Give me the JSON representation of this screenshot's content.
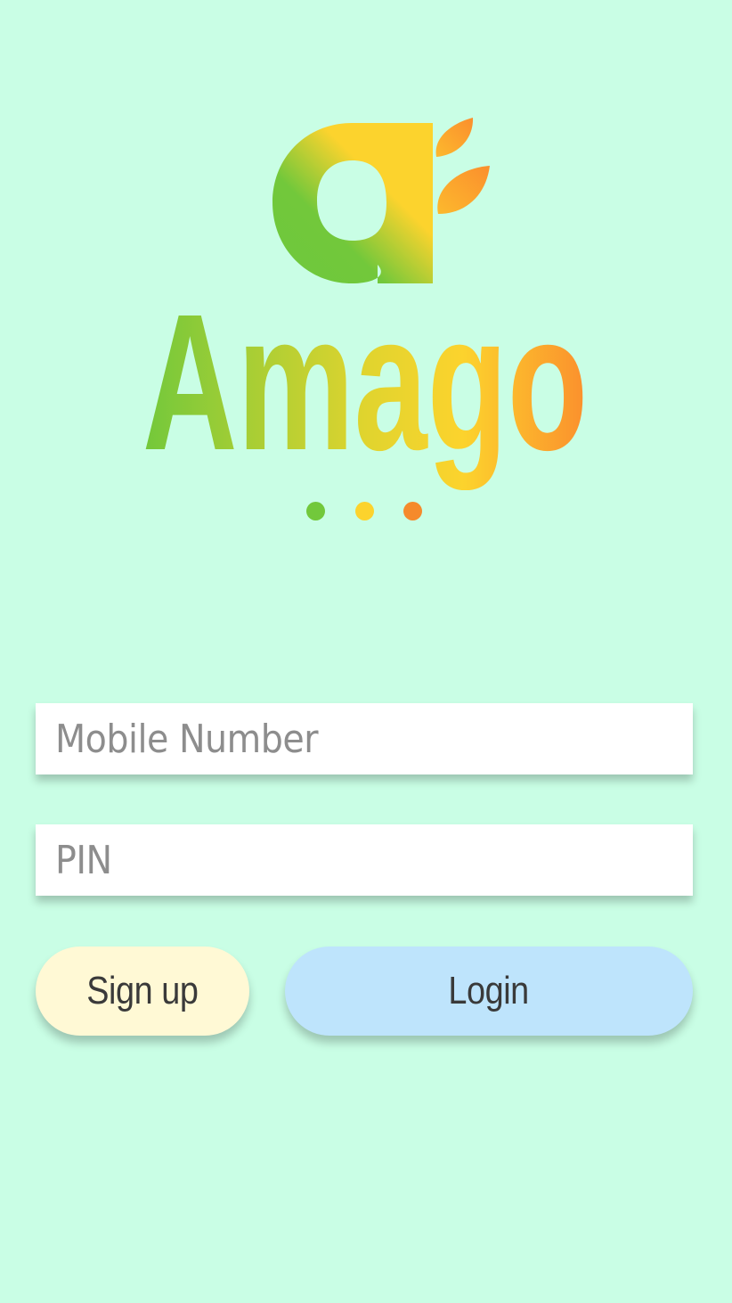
{
  "app": {
    "brand_name": "Amago"
  },
  "colors": {
    "background": "#c9fee5",
    "brand_green": "#72c83b",
    "brand_yellow": "#fcd32d",
    "brand_orange": "#fb8f2d",
    "signup_bg": "#fff9d5",
    "login_bg": "#bee4fc",
    "field_bg": "#ffffff"
  },
  "logo": {
    "icon": "amago-leaf-a-logo-icon",
    "dots": [
      "#72c83b",
      "#fcd32d",
      "#f58a2b"
    ]
  },
  "form": {
    "mobile": {
      "placeholder": "Mobile Number",
      "value": ""
    },
    "pin": {
      "placeholder": "PIN",
      "value": ""
    }
  },
  "actions": {
    "signup_label": "Sign up",
    "login_label": "Login"
  }
}
